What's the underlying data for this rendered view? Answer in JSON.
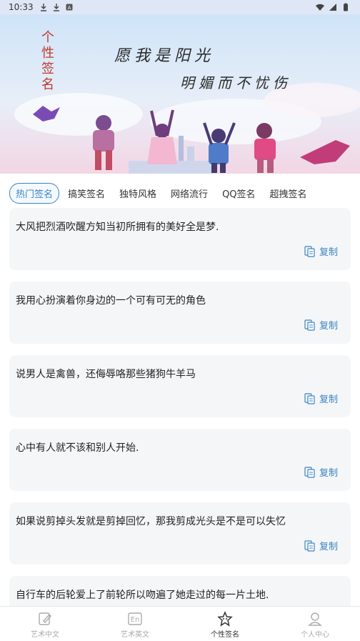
{
  "status_bar": {
    "time": "10:33",
    "icons": [
      "download-icon",
      "download-icon",
      "app-icon"
    ],
    "right_icons": [
      "wifi-icon",
      "signal-icon",
      "battery-icon"
    ]
  },
  "banner": {
    "vertical_title": "个性签名",
    "line1": "愿我是阳光",
    "line2": "明媚而不忧伤"
  },
  "tabs": [
    {
      "label": "热门签名",
      "active": true
    },
    {
      "label": "搞笑签名",
      "active": false
    },
    {
      "label": "独特风格",
      "active": false
    },
    {
      "label": "网络流行",
      "active": false
    },
    {
      "label": "QQ签名",
      "active": false
    },
    {
      "label": "超拽签名",
      "active": false
    }
  ],
  "copy_label": "复制",
  "cards": [
    {
      "text": "大风把烈酒吹醒方知当初所拥有的美好全是梦."
    },
    {
      "text": "我用心扮演着你身边的一个可有可无的角色"
    },
    {
      "text": "说男人是禽兽，还侮辱咯那些猪狗牛羊马"
    },
    {
      "text": "心中有人就不该和别人开始."
    },
    {
      "text": "如果说剪掉头发就是剪掉回忆，那我剪成光头是不是可以失忆"
    },
    {
      "text": "自行车的后轮爱上了前轮所以吻遍了她走过的每一片土地."
    }
  ],
  "bottom_nav": [
    {
      "label": "艺术中文",
      "icon": "pen-icon",
      "active": false
    },
    {
      "label": "艺术英文",
      "icon": "en-icon",
      "active": false
    },
    {
      "label": "个性签名",
      "icon": "star-face-icon",
      "active": true
    },
    {
      "label": "个人中心",
      "icon": "user-icon",
      "active": false
    }
  ],
  "colors": {
    "accent": "#3b84c4",
    "card_bg": "#f5f6f8",
    "inactive_nav": "#aaaaaa"
  }
}
